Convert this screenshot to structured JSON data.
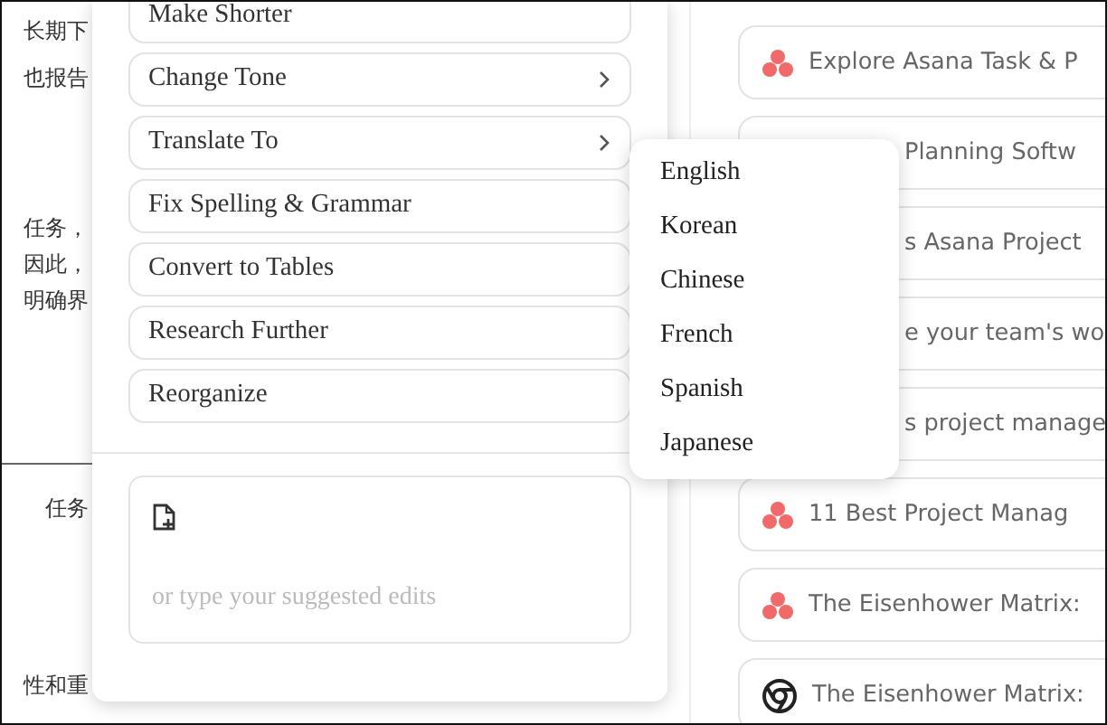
{
  "background_text": [
    {
      "text": "长期下"
    },
    {
      "text": "也报告"
    },
    {
      "text": "任务，"
    },
    {
      "text": "因此，"
    },
    {
      "text": "明确界"
    },
    {
      "text": "任务"
    },
    {
      "text": "性和重"
    }
  ],
  "menu": [
    {
      "label": "Make Shorter",
      "submenu": false
    },
    {
      "label": "Change Tone",
      "submenu": true
    },
    {
      "label": "Translate To",
      "submenu": true
    },
    {
      "label": "Fix Spelling & Grammar",
      "submenu": false
    },
    {
      "label": "Convert to Tables",
      "submenu": false
    },
    {
      "label": "Research Further",
      "submenu": false
    },
    {
      "label": "Reorganize",
      "submenu": false
    }
  ],
  "edit_field": {
    "placeholder": "or type your suggested edits"
  },
  "languages": [
    "English",
    "Korean",
    "Chinese",
    "French",
    "Spanish",
    "Japanese"
  ],
  "results": [
    {
      "title": "Explore Asana Task & P",
      "kind": "asana"
    },
    {
      "title": "Planning Softw",
      "kind": "covered"
    },
    {
      "title": "s Asana Project",
      "kind": "covered"
    },
    {
      "title": "e your team's wo",
      "kind": "covered"
    },
    {
      "title": "s project manage",
      "kind": "covered"
    },
    {
      "title": "11 Best Project Manag",
      "kind": "asana"
    },
    {
      "title": "The Eisenhower Matrix:",
      "kind": "asana"
    },
    {
      "title": "The Eisenhower Matrix:",
      "kind": "chrome"
    }
  ]
}
